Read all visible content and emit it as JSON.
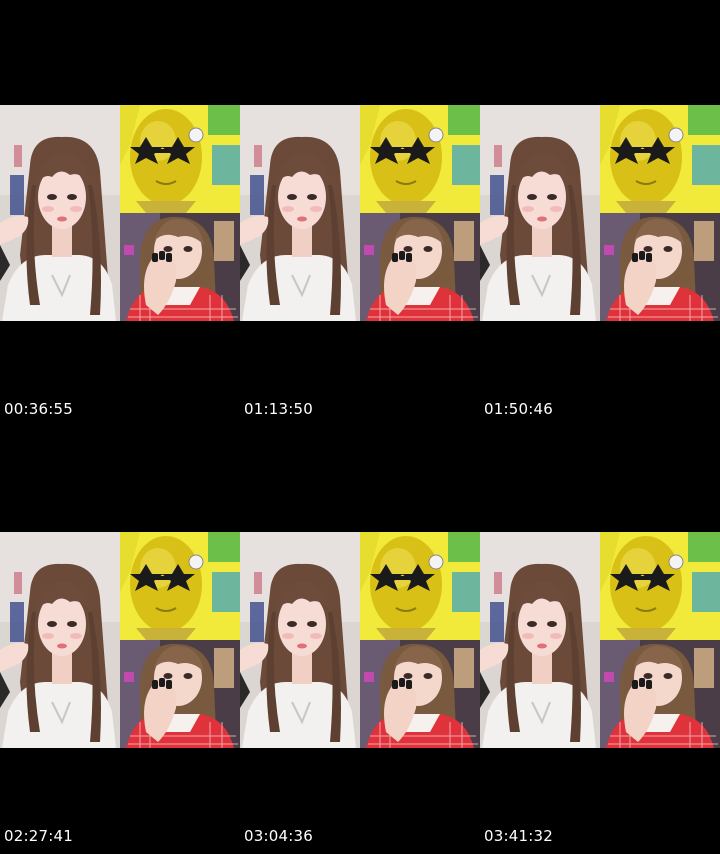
{
  "contact_sheet": {
    "frames": [
      {
        "timestamp": "00:36:55"
      },
      {
        "timestamp": "01:13:50"
      },
      {
        "timestamp": "01:50:46"
      },
      {
        "timestamp": "02:27:41"
      },
      {
        "timestamp": "03:04:36"
      },
      {
        "timestamp": "03:41:32"
      }
    ]
  },
  "colors": {
    "background": "#000000",
    "mask_yellow": "#e8d21a",
    "costume_yellow": "#f2ea3a",
    "top_red": "#e0323a",
    "hair_brown": "#6b4a3a",
    "wall_grey": "#d9d4d2"
  }
}
